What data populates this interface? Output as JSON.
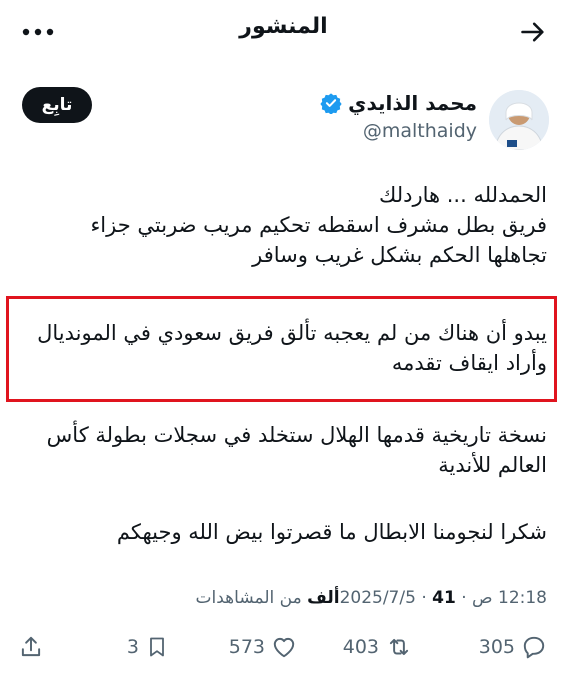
{
  "header": {
    "title": "المنشور",
    "icons": {
      "back": "arrow-right-icon",
      "more": "more-horizontal-icon"
    }
  },
  "author": {
    "name": "محمد الذايدي",
    "handle": "@malthaidy",
    "verified": true,
    "follow_label": "تابِع"
  },
  "tweet": {
    "paragraphs": [
      [
        "الحمدلله ... هاردلك",
        "فريق بطل مشرف اسقطه تحكيم مريب ضربتي جزاء",
        "تجاهلها الحكم بشكل غريب وسافر"
      ],
      [
        "يبدو أن هناك من لم يعجبه تألق فريق سعودي في المونديال",
        "وأراد ايقاف تقدمه"
      ],
      [
        "نسخة تاريخية قدمها الهلال ستخلد في سجلات بطولة كأس",
        "العالم للأندية"
      ],
      [
        "شكرا لنجومنا الابطال ما قصرتوا بيض الله وجيهكم"
      ]
    ],
    "highlight_color": "#e0141e"
  },
  "meta": {
    "time": "12:18 ص",
    "date": "2025/7/5",
    "views_count": "41",
    "views_unit": "ألف",
    "views_label": "من المشاهدات"
  },
  "actions": {
    "replies": "305",
    "reposts": "403",
    "likes": "573",
    "bookmarks": "3",
    "icons": [
      "reply-icon",
      "repost-icon",
      "like-icon",
      "bookmark-icon",
      "share-icon"
    ]
  }
}
